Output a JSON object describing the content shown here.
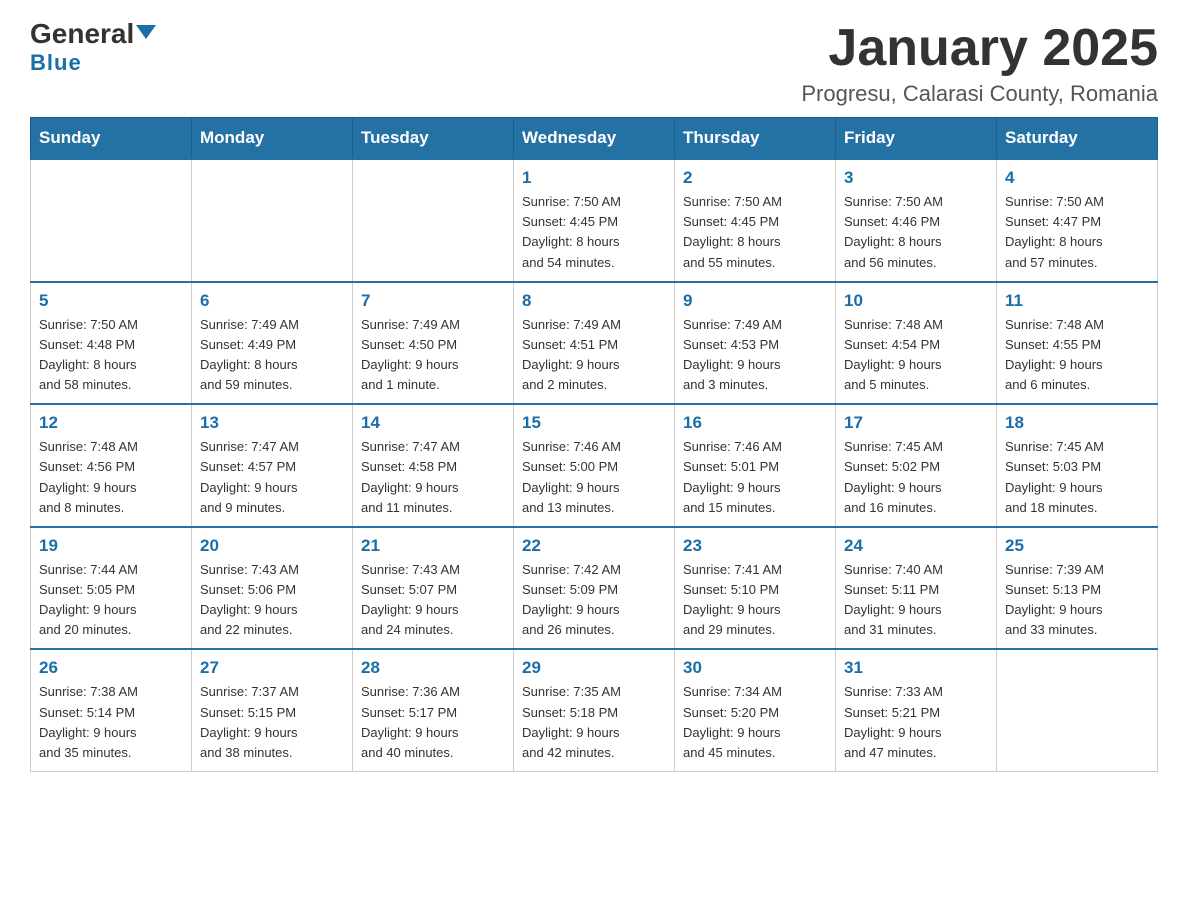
{
  "header": {
    "logo_general": "General",
    "logo_blue": "Blue",
    "title": "January 2025",
    "subtitle": "Progresu, Calarasi County, Romania"
  },
  "days_of_week": [
    "Sunday",
    "Monday",
    "Tuesday",
    "Wednesday",
    "Thursday",
    "Friday",
    "Saturday"
  ],
  "weeks": [
    [
      {
        "day": "",
        "info": ""
      },
      {
        "day": "",
        "info": ""
      },
      {
        "day": "",
        "info": ""
      },
      {
        "day": "1",
        "info": "Sunrise: 7:50 AM\nSunset: 4:45 PM\nDaylight: 8 hours\nand 54 minutes."
      },
      {
        "day": "2",
        "info": "Sunrise: 7:50 AM\nSunset: 4:45 PM\nDaylight: 8 hours\nand 55 minutes."
      },
      {
        "day": "3",
        "info": "Sunrise: 7:50 AM\nSunset: 4:46 PM\nDaylight: 8 hours\nand 56 minutes."
      },
      {
        "day": "4",
        "info": "Sunrise: 7:50 AM\nSunset: 4:47 PM\nDaylight: 8 hours\nand 57 minutes."
      }
    ],
    [
      {
        "day": "5",
        "info": "Sunrise: 7:50 AM\nSunset: 4:48 PM\nDaylight: 8 hours\nand 58 minutes."
      },
      {
        "day": "6",
        "info": "Sunrise: 7:49 AM\nSunset: 4:49 PM\nDaylight: 8 hours\nand 59 minutes."
      },
      {
        "day": "7",
        "info": "Sunrise: 7:49 AM\nSunset: 4:50 PM\nDaylight: 9 hours\nand 1 minute."
      },
      {
        "day": "8",
        "info": "Sunrise: 7:49 AM\nSunset: 4:51 PM\nDaylight: 9 hours\nand 2 minutes."
      },
      {
        "day": "9",
        "info": "Sunrise: 7:49 AM\nSunset: 4:53 PM\nDaylight: 9 hours\nand 3 minutes."
      },
      {
        "day": "10",
        "info": "Sunrise: 7:48 AM\nSunset: 4:54 PM\nDaylight: 9 hours\nand 5 minutes."
      },
      {
        "day": "11",
        "info": "Sunrise: 7:48 AM\nSunset: 4:55 PM\nDaylight: 9 hours\nand 6 minutes."
      }
    ],
    [
      {
        "day": "12",
        "info": "Sunrise: 7:48 AM\nSunset: 4:56 PM\nDaylight: 9 hours\nand 8 minutes."
      },
      {
        "day": "13",
        "info": "Sunrise: 7:47 AM\nSunset: 4:57 PM\nDaylight: 9 hours\nand 9 minutes."
      },
      {
        "day": "14",
        "info": "Sunrise: 7:47 AM\nSunset: 4:58 PM\nDaylight: 9 hours\nand 11 minutes."
      },
      {
        "day": "15",
        "info": "Sunrise: 7:46 AM\nSunset: 5:00 PM\nDaylight: 9 hours\nand 13 minutes."
      },
      {
        "day": "16",
        "info": "Sunrise: 7:46 AM\nSunset: 5:01 PM\nDaylight: 9 hours\nand 15 minutes."
      },
      {
        "day": "17",
        "info": "Sunrise: 7:45 AM\nSunset: 5:02 PM\nDaylight: 9 hours\nand 16 minutes."
      },
      {
        "day": "18",
        "info": "Sunrise: 7:45 AM\nSunset: 5:03 PM\nDaylight: 9 hours\nand 18 minutes."
      }
    ],
    [
      {
        "day": "19",
        "info": "Sunrise: 7:44 AM\nSunset: 5:05 PM\nDaylight: 9 hours\nand 20 minutes."
      },
      {
        "day": "20",
        "info": "Sunrise: 7:43 AM\nSunset: 5:06 PM\nDaylight: 9 hours\nand 22 minutes."
      },
      {
        "day": "21",
        "info": "Sunrise: 7:43 AM\nSunset: 5:07 PM\nDaylight: 9 hours\nand 24 minutes."
      },
      {
        "day": "22",
        "info": "Sunrise: 7:42 AM\nSunset: 5:09 PM\nDaylight: 9 hours\nand 26 minutes."
      },
      {
        "day": "23",
        "info": "Sunrise: 7:41 AM\nSunset: 5:10 PM\nDaylight: 9 hours\nand 29 minutes."
      },
      {
        "day": "24",
        "info": "Sunrise: 7:40 AM\nSunset: 5:11 PM\nDaylight: 9 hours\nand 31 minutes."
      },
      {
        "day": "25",
        "info": "Sunrise: 7:39 AM\nSunset: 5:13 PM\nDaylight: 9 hours\nand 33 minutes."
      }
    ],
    [
      {
        "day": "26",
        "info": "Sunrise: 7:38 AM\nSunset: 5:14 PM\nDaylight: 9 hours\nand 35 minutes."
      },
      {
        "day": "27",
        "info": "Sunrise: 7:37 AM\nSunset: 5:15 PM\nDaylight: 9 hours\nand 38 minutes."
      },
      {
        "day": "28",
        "info": "Sunrise: 7:36 AM\nSunset: 5:17 PM\nDaylight: 9 hours\nand 40 minutes."
      },
      {
        "day": "29",
        "info": "Sunrise: 7:35 AM\nSunset: 5:18 PM\nDaylight: 9 hours\nand 42 minutes."
      },
      {
        "day": "30",
        "info": "Sunrise: 7:34 AM\nSunset: 5:20 PM\nDaylight: 9 hours\nand 45 minutes."
      },
      {
        "day": "31",
        "info": "Sunrise: 7:33 AM\nSunset: 5:21 PM\nDaylight: 9 hours\nand 47 minutes."
      },
      {
        "day": "",
        "info": ""
      }
    ]
  ]
}
